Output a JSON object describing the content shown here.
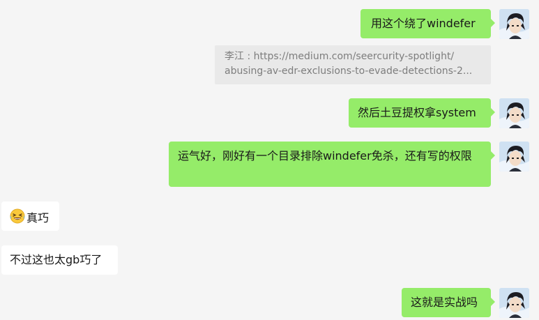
{
  "messages": [
    {
      "text": "用这个绕了windefer"
    },
    {
      "text": "然后土豆提权拿system"
    },
    {
      "text": "运气好，刚好有一个目录排除windefer免杀，还有写的权限"
    },
    {
      "text": "真巧",
      "emoji": "grinning-squinting-tears-emoji"
    },
    {
      "text": "不过这也太gb巧了"
    },
    {
      "text": "这就是实战吗"
    }
  ],
  "quote": {
    "line1": "李江 : https://medium.com/seercurity-spotlight/",
    "line2": "abusing-av-edr-exclusions-to-evade-detections-2..."
  },
  "colors": {
    "background": "#f5f5f5",
    "sent_bubble": "#95ec69",
    "received_bubble": "#ffffff",
    "quote_bg": "#e9e9e9",
    "quote_text": "#7d7d7d"
  },
  "icons": {
    "avatar": "user-avatar-anime-boy",
    "emoji": "grinning-squinting-tears-emoji"
  }
}
